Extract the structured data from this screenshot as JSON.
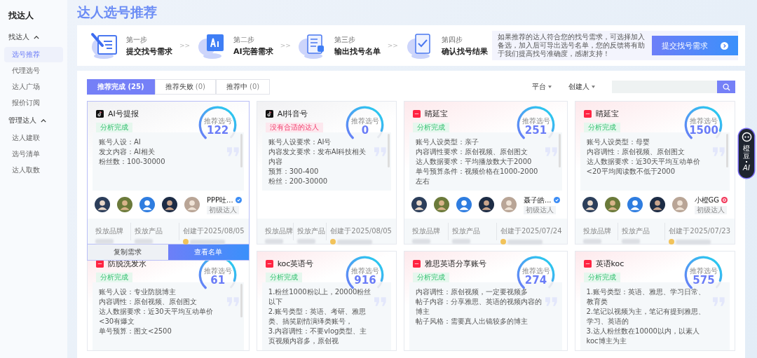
{
  "sidebar": {
    "title": "找达人",
    "groups": [
      {
        "label": "找达人",
        "expanded": true,
        "items": [
          {
            "label": "选号推荐",
            "selected": true
          },
          {
            "label": "代理选号",
            "selected": false
          },
          {
            "label": "达人广场",
            "selected": false
          },
          {
            "label": "报价订阅",
            "selected": false
          }
        ]
      },
      {
        "label": "管理达人",
        "expanded": true,
        "items": [
          {
            "label": "达人建联",
            "selected": false
          },
          {
            "label": "选号清单",
            "selected": false
          },
          {
            "label": "达人取数",
            "selected": false
          }
        ]
      }
    ]
  },
  "page_title": "达人选号推荐",
  "steps": [
    {
      "kind": "form",
      "step": "第一步",
      "title": "提交找号需求",
      "next_arrow": ">>"
    },
    {
      "kind": "ai",
      "step": "第二步",
      "title": "AI完善需求",
      "next_arrow": ">>"
    },
    {
      "kind": "list",
      "step": "第三步",
      "title": "输出找号名单",
      "next_arrow": ">>"
    },
    {
      "kind": "check",
      "step": "第四步",
      "title": "确认找号结果"
    }
  ],
  "notice": "如果推荐的达人符合您的找号需求，可选择加入备选，加入后可导出选号名单，您的反馈将有助于我们提高找号准确度，感谢支持！",
  "submit_button": "提交找号需求",
  "tabs": [
    {
      "label": "推荐完成",
      "count": "(25)",
      "selected": true
    },
    {
      "label": "推荐失败",
      "count": "(0)",
      "selected": false
    },
    {
      "label": "推荐中",
      "count": "(0)",
      "selected": false
    }
  ],
  "filters": [
    "平台",
    "创建人"
  ],
  "cards": [
    {
      "kind": "douyin",
      "title": "AI号提报",
      "status": {
        "kind": "ok",
        "label": "分析完成"
      },
      "gauge_label": "推荐选号",
      "count": "122",
      "lines": [
        "账号人设：AI",
        "发文内容：AI相关",
        "粉丝数：100-30000"
      ],
      "creator": {
        "name": "PPP吐...",
        "level": "初级达人",
        "kind": "verified"
      },
      "footer": [
        "投放品牌",
        "投放产品",
        "创建于2025/08/05"
      ],
      "hovered": true,
      "actions": [
        "复制需求",
        "查看名单"
      ]
    },
    {
      "kind": "douyin",
      "title": "AI抖音号",
      "status": {
        "kind": "fail",
        "label": "没有合适的达人"
      },
      "gauge_label": "推荐选号",
      "count": "0",
      "lines": [
        "账号人设要求：AI号",
        "内容发文要求：发布AI科技相关内容",
        "预算：300-400",
        "粉丝：200-30000"
      ],
      "footer": [
        "投放品牌",
        "投放产品",
        "创建于2025/08/05"
      ],
      "hovered": false
    },
    {
      "kind": "xiaohongshu",
      "title": "睛延宝",
      "status": {
        "kind": "ok",
        "label": "分析完成"
      },
      "gauge_label": "推荐选号",
      "count": "251",
      "lines": [
        "账号人设类型：亲子",
        "内容调性要求：原创视频、原创图文",
        "达人数据要求：平均播放数大于2000",
        "单号预算条件：视频价格在1000-2000左右"
      ],
      "creator": {
        "name": "聂子皓...",
        "level": "初级达人",
        "kind": "verified"
      },
      "footer": [
        "投放品牌",
        "投放产品",
        "创建于2025/07/24"
      ],
      "hovered": false
    },
    {
      "kind": "xiaohongshu",
      "title": "睛延宝",
      "status": {
        "kind": "ok",
        "label": "分析完成"
      },
      "gauge_label": "推荐选号",
      "count": "1500",
      "lines": [
        "账号人设类型：母婴",
        "内容调性：原创视频、原创图文",
        "达人数据要求：近30天平均互动单价<20平均阅读数不低于2000"
      ],
      "creator": {
        "name": "小橙GG",
        "level": "初级达人",
        "kind": "alert"
      },
      "footer": [
        "投放品牌",
        "投放产品",
        "创建于2025/07/23"
      ],
      "hovered": false
    },
    {
      "kind": "xiaohongshu",
      "title": "防脱洗发水",
      "status": {
        "kind": "ok",
        "label": "分析完成"
      },
      "gauge_label": "推荐选号",
      "count": "61",
      "lines": [
        "账号人设：专业防脱博主",
        "内容调性：原创视频、原创图文",
        "达人数据要求：近30天平均互动单价<30有爆文",
        "单号预算：图文<2500"
      ],
      "hovered": false
    },
    {
      "kind": "xiaohongshu",
      "title": "koc英语号",
      "status": {
        "kind": "ok",
        "label": "分析完成"
      },
      "gauge_label": "推荐选号",
      "count": "916",
      "lines": [
        "1.粉丝1000粉以上，20000粉丝以下",
        "2.账号类型：英语、考研、雅思类、搞笑剧情演绎类账号，",
        "3.内容调性：不要vlog类型、主页视频内容多，原创视"
      ],
      "hovered": false
    },
    {
      "kind": "xiaohongshu",
      "title": "雅思英语分享账号",
      "status": {
        "kind": "ok",
        "label": "分析完成"
      },
      "gauge_label": "推荐选号",
      "count": "274",
      "lines": [
        "内容调性：原创视频，一定要视频多",
        "帖子内容：分享雅思、英语的视频内容的博主",
        "帖子风格：需要真人出镜较多的博主"
      ],
      "hovered": false
    },
    {
      "kind": "xiaohongshu",
      "title": "英语koc",
      "status": {
        "kind": "ok",
        "label": "分析完成"
      },
      "gauge_label": "推荐选号",
      "count": "575",
      "lines": [
        "1.账号类型：英语、雅思、学习日常、教育类",
        "2.笔记以视频为主，笔记有提到雅思、学习、英语的",
        "3.达人粉丝数在10000以内，以素人koc博主为主"
      ],
      "hovered": false
    }
  ],
  "assistant": {
    "label": "橙豆",
    "sub": "AI"
  }
}
